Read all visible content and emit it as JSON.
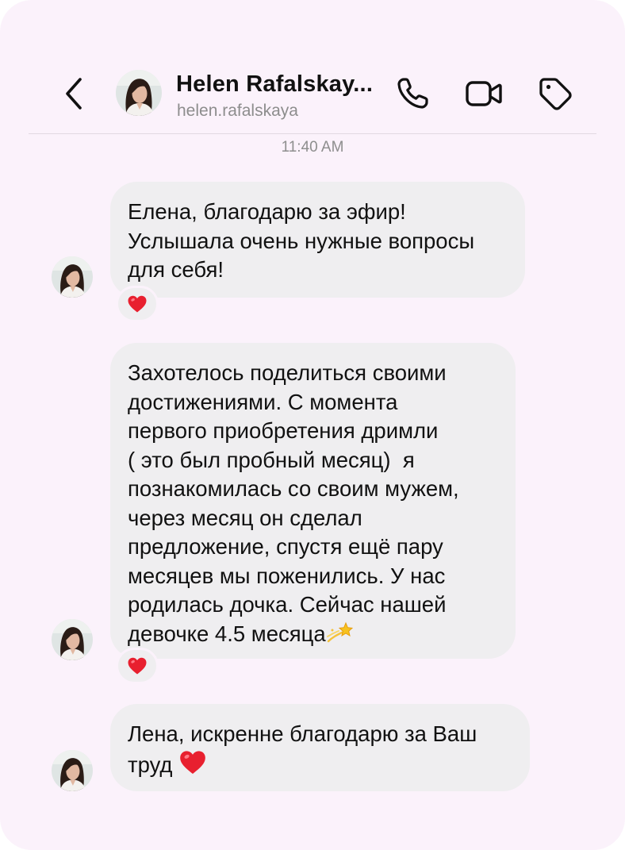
{
  "header": {
    "title": "Helen Rafalskay...",
    "handle": "helen.rafalskaya"
  },
  "timestamp": "11:40 AM",
  "messages": [
    {
      "lines": [
        "Елена, благодарю за эфир!",
        "Услышала очень нужные вопросы",
        "для себя!"
      ],
      "reaction": "red-heart"
    },
    {
      "lines": [
        "Захотелось поделиться своими",
        "достижениями. С момента",
        "первого приобретения дримли",
        "( это был пробный месяц)  я",
        "познакомилась со своим мужем,",
        "через месяц он сделал",
        "предложение, спустя ещё пару",
        "месяцев мы поженились. У нас",
        "родилась дочка. Сейчас нашей",
        "девочке 4.5 месяца"
      ],
      "trailing_emoji": "dizzy-star",
      "reaction": "red-heart"
    },
    {
      "lines": [
        "Лена, искренне благодарю за Ваш",
        "труд"
      ],
      "trailing_emoji": "red-heart"
    }
  ],
  "colors": {
    "background": "#fbf2fb",
    "bubble": "#efeef0",
    "heart": "#e8202f",
    "text": "#111111",
    "muted": "#8e8e8e"
  },
  "icons": [
    "back-chevron-icon",
    "phone-icon",
    "video-camera-icon",
    "tag-icon"
  ]
}
